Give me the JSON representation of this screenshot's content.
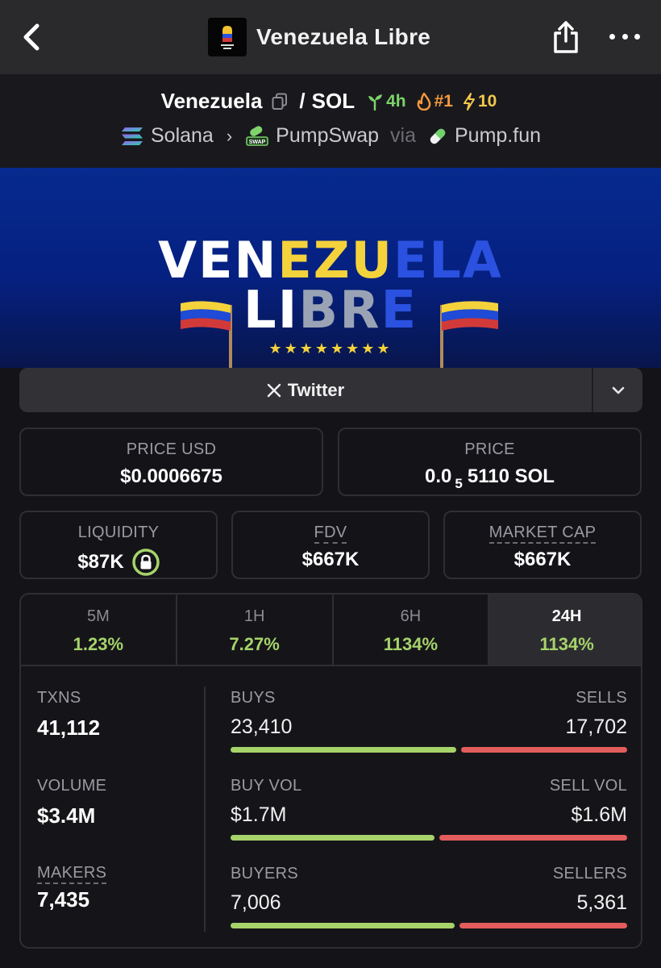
{
  "nav": {
    "title": "Venezuela Libre",
    "back_icon": "chevron-left-icon",
    "share_icon": "share-icon",
    "more_icon": "more-dots-icon"
  },
  "pair": {
    "base": "Venezuela",
    "separator": "/",
    "quote": "SOL",
    "age_badge": "4h",
    "rank_badge": "#1",
    "boost_badge": "10",
    "chain": "Solana",
    "dex": "PumpSwap",
    "via": "via",
    "launchpad": "Pump.fun",
    "colors": {
      "age": "#7ed36a",
      "rank": "#f59a3c",
      "boost": "#f2c94c"
    }
  },
  "banner": {
    "line1": [
      "VEN",
      "EZU",
      "ELA"
    ],
    "line2": [
      "LI",
      "BR",
      "E"
    ],
    "stars": "★★★★★★★★",
    "colors": {
      "white": "#ffffff",
      "yellow": "#f4d23c",
      "blue": "#2b51e0",
      "gray": "#9aa3b5"
    }
  },
  "links": {
    "twitter_label": "Twitter"
  },
  "stats": {
    "price_usd_label": "PRICE USD",
    "price_usd": "$0.0006675",
    "price_label": "PRICE",
    "price_prefix": "0.0",
    "price_sub": "5",
    "price_suffix": "5110 SOL",
    "liquidity_label": "LIQUIDITY",
    "liquidity": "$87K",
    "fdv_label": "FDV",
    "fdv": "$667K",
    "mcap_label": "MARKET CAP",
    "mcap": "$667K"
  },
  "timeframes": [
    {
      "label": "5M",
      "value": "1.23%"
    },
    {
      "label": "1H",
      "value": "7.27%"
    },
    {
      "label": "6H",
      "value": "1134%"
    },
    {
      "label": "24H",
      "value": "1134%",
      "active": true
    }
  ],
  "activity": {
    "txns_label": "TXNS",
    "txns": "41,112",
    "volume_label": "VOLUME",
    "volume": "$3.4M",
    "makers_label": "MAKERS",
    "makers": "7,435",
    "buys_label": "BUYS",
    "buys": "23,410",
    "sells_label": "SELLS",
    "sells": "17,702",
    "buys_fraction": 0.569,
    "buyvol_label": "BUY VOL",
    "buyvol": "$1.7M",
    "sellvol_label": "SELL VOL",
    "sellvol": "$1.6M",
    "buyvol_fraction": 0.515,
    "buyers_label": "BUYERS",
    "buyers": "7,006",
    "sellers_label": "SELLERS",
    "sellers": "5,361",
    "buyers_fraction": 0.566,
    "colors": {
      "positive": "#a6d36a",
      "negative": "#e35d5d"
    }
  }
}
